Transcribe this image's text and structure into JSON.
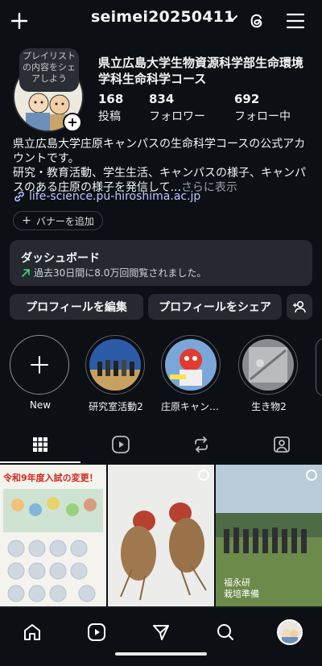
{
  "header": {
    "username": "seimei20250411"
  },
  "profile": {
    "note_bubble": "プレイリストの内容をシェアしよう",
    "display_name": "県立広島大学生物資源科学部生命環境学科生命科学コース",
    "stats": [
      {
        "count": "168",
        "label": "投稿"
      },
      {
        "count": "834",
        "label": "フォロワー"
      },
      {
        "count": "692",
        "label": "フォロー中"
      }
    ],
    "bio_line1": "県立広島大学庄原キャンパスの生命科学コースの公式アカウントです。",
    "bio_line2": "研究・教育活動、学生生活、キャンパスの様子、キャンパスのある庄原の様子を発信して...",
    "bio_more": "さらに表示",
    "link": "life-science.pu-hiroshima.ac.jp",
    "banner_button": "バナーを追加"
  },
  "dashboard": {
    "title": "ダッシュボード",
    "subtitle": "過去30日間に8.0万回閲覧されました。"
  },
  "actions": {
    "edit": "プロフィールを編集",
    "share": "プロフィールをシェア"
  },
  "highlights": [
    {
      "label": "New"
    },
    {
      "label": "研究室活動2"
    },
    {
      "label": "庄原キャンパ..."
    },
    {
      "label": "生き物2"
    }
  ],
  "posts": [
    {
      "caption": "令和9年度入試の変更！"
    },
    {
      "caption": ""
    },
    {
      "caption": "福永研\n栽培準備"
    }
  ],
  "colors": {
    "background": "#0c0f14",
    "surface": "#262a30",
    "link": "#b7c8ff",
    "accent_green": "#3ddc84"
  }
}
